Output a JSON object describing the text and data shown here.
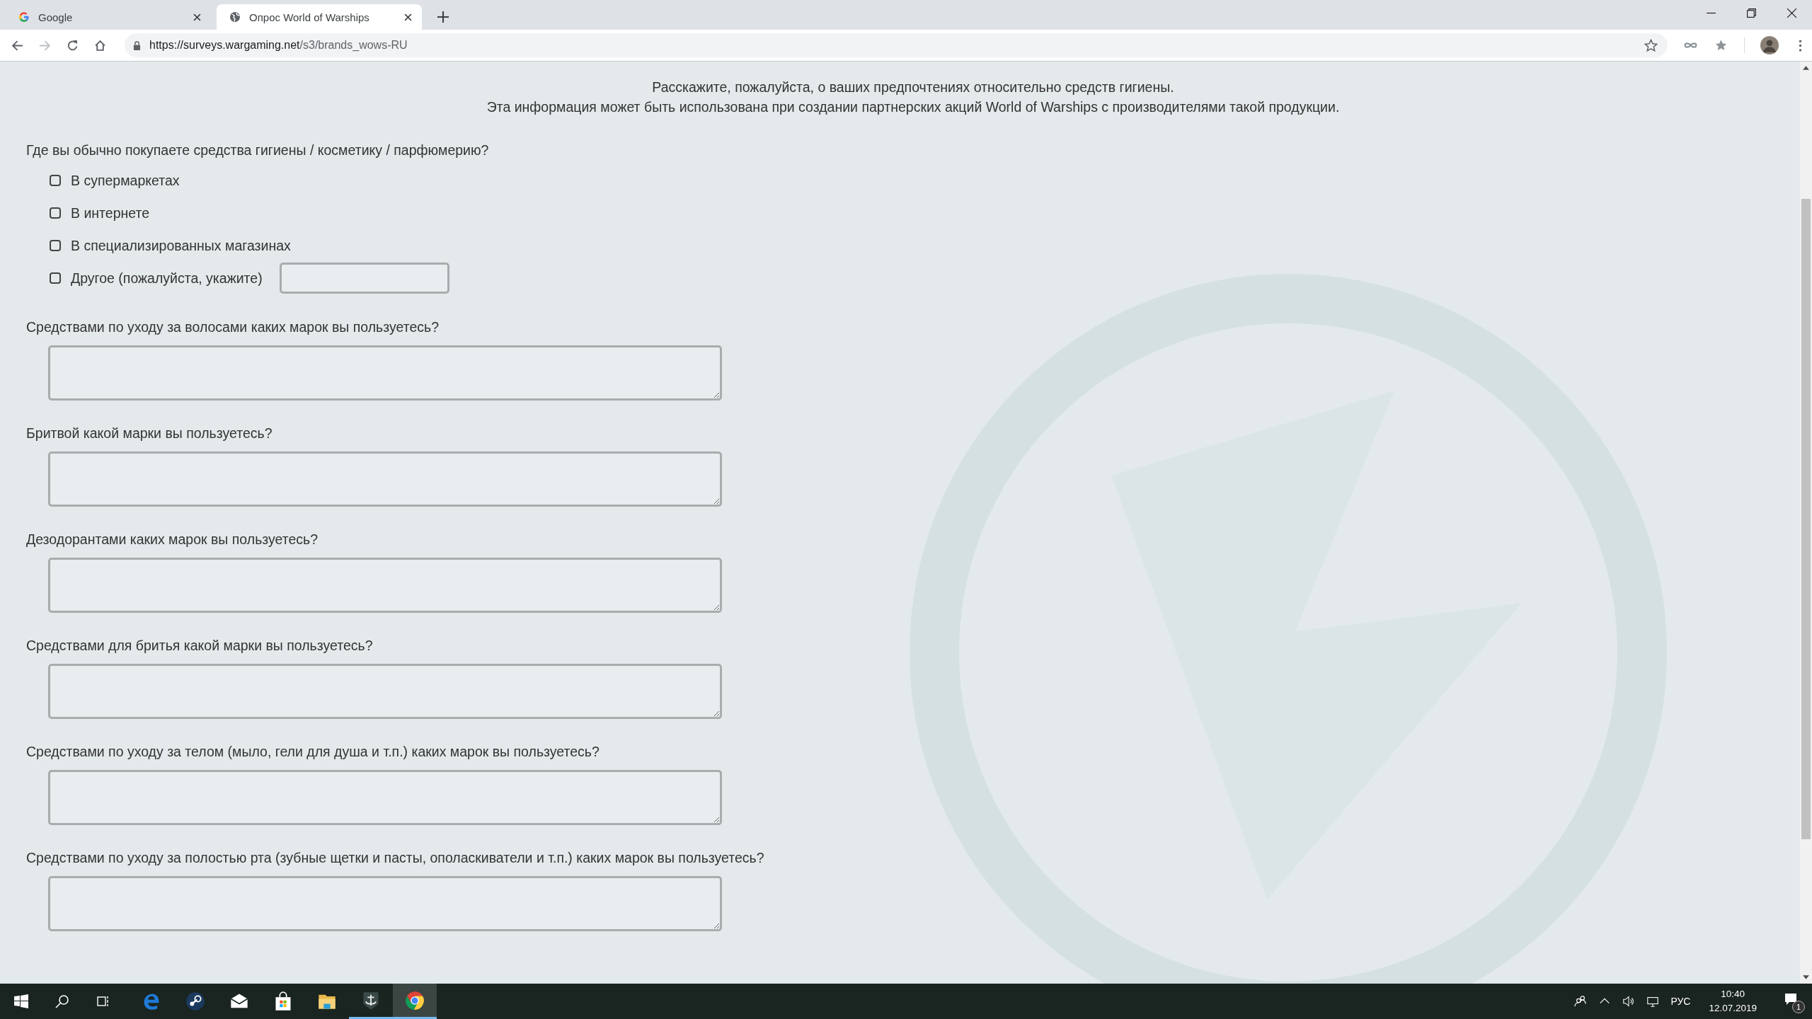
{
  "browser": {
    "tabs": [
      {
        "title": "Google",
        "selected": false
      },
      {
        "title": "Опрос World of Warships",
        "selected": true
      }
    ],
    "url": {
      "host": "https://surveys.wargaming.net",
      "path": "/s3/brands_wows-RU"
    }
  },
  "survey": {
    "intro": [
      "Расскажите, пожалуйста, о ваших предпочтениях относительно средств гигиены.",
      "Эта информация может быть использована при создании партнерских акций World of Warships с производителями такой продукции."
    ],
    "questions": [
      {
        "kind": "checkboxes",
        "text": "Где вы обычно покупаете средства гигиены / косметику / парфюмерию?",
        "options": [
          {
            "label": "В супермаркетах",
            "checked": false,
            "kind": "plain"
          },
          {
            "label": "В интернете",
            "checked": false,
            "kind": "plain"
          },
          {
            "label": "В специализированных магазинах",
            "checked": false,
            "kind": "plain"
          },
          {
            "label": "Другое (пожалуйста, укажите)",
            "checked": false,
            "kind": "other"
          }
        ]
      },
      {
        "kind": "textarea",
        "text": "Средствами по уходу за волосами каких марок вы пользуетесь?"
      },
      {
        "kind": "textarea",
        "text": "Бритвой какой марки вы пользуетесь?"
      },
      {
        "kind": "textarea",
        "text": "Дезодорантами каких марок вы пользуетесь?"
      },
      {
        "kind": "textarea",
        "text": "Средствами для бритья какой марки вы пользуетесь?"
      },
      {
        "kind": "textarea",
        "text": "Средствами по уходу за телом (мыло, гели для душа и т.п.) каких марок вы пользуетесь?"
      },
      {
        "kind": "textarea",
        "text": "Средствами по уходу за полостью рта (зубные щетки и пасты, ополаскиватели и т.п.) каких марок вы пользуетесь?"
      }
    ]
  },
  "taskbar": {
    "apps": [
      {
        "running": false,
        "selected": false
      },
      {
        "running": false,
        "selected": false
      },
      {
        "running": false,
        "selected": false
      },
      {
        "running": false,
        "selected": false
      },
      {
        "running": false,
        "selected": false
      },
      {
        "running": true,
        "selected": false
      },
      {
        "running": true,
        "selected": true
      }
    ],
    "tray": {
      "language": "РУС",
      "time": "10:40",
      "date": "12.07.2019",
      "notifications": "1"
    }
  }
}
